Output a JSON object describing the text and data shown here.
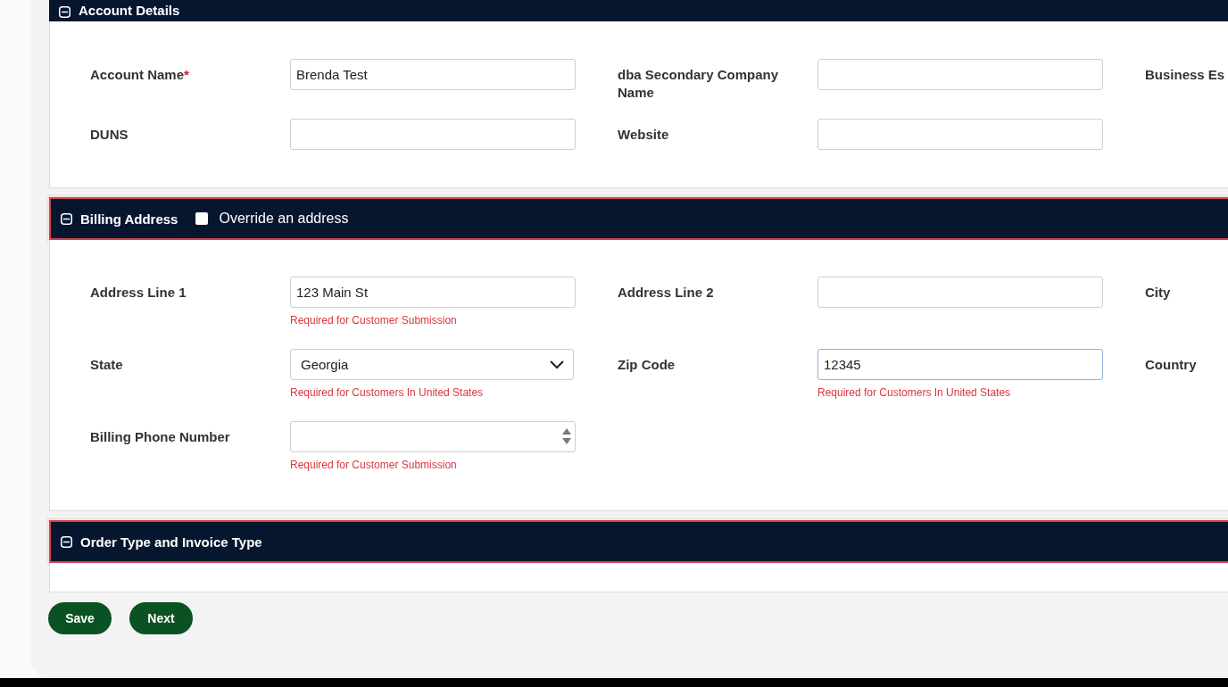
{
  "sections": [
    {
      "title": "Account Details",
      "expanded": true,
      "invalid": false,
      "fields": [
        {
          "label": "Account Name",
          "required_mark": "*",
          "kind": "text",
          "value": "Brenda Test",
          "focused": false
        },
        {
          "label": "dba Secondary Company Name",
          "kind": "text",
          "focused": false
        },
        {
          "label": "Business Es",
          "kind": "none"
        },
        {
          "label": "DUNS",
          "kind": "text",
          "focused": false
        },
        {
          "label": "Website",
          "kind": "text",
          "focused": false
        }
      ]
    },
    {
      "title": "Billing Address",
      "expanded": true,
      "invalid": true,
      "override": {
        "label": "Override an address",
        "checked": false
      },
      "fields": [
        {
          "label": "Address Line 1",
          "kind": "text",
          "value": "123 Main St",
          "helper": "Required for Customer Submission",
          "focused": false
        },
        {
          "label": "Address Line 2",
          "kind": "text",
          "focused": false
        },
        {
          "label": "City",
          "kind": "none"
        },
        {
          "label": "State",
          "kind": "select",
          "value": "Georgia",
          "helper": "Required for Customers In United States",
          "focused": false
        },
        {
          "label": "Zip Code",
          "kind": "text",
          "value": "12345",
          "helper": "Required for Customers In United States",
          "focused": true
        },
        {
          "label": "Country",
          "kind": "none"
        },
        {
          "label": "Billing Phone Number",
          "kind": "number",
          "helper": "Required for Customer Submission",
          "focused": false
        }
      ]
    },
    {
      "title": "Order Type and Invoice Type",
      "expanded": true,
      "invalid": true
    }
  ],
  "buttons": [
    {
      "label": "Save"
    },
    {
      "label": "Next"
    }
  ]
}
